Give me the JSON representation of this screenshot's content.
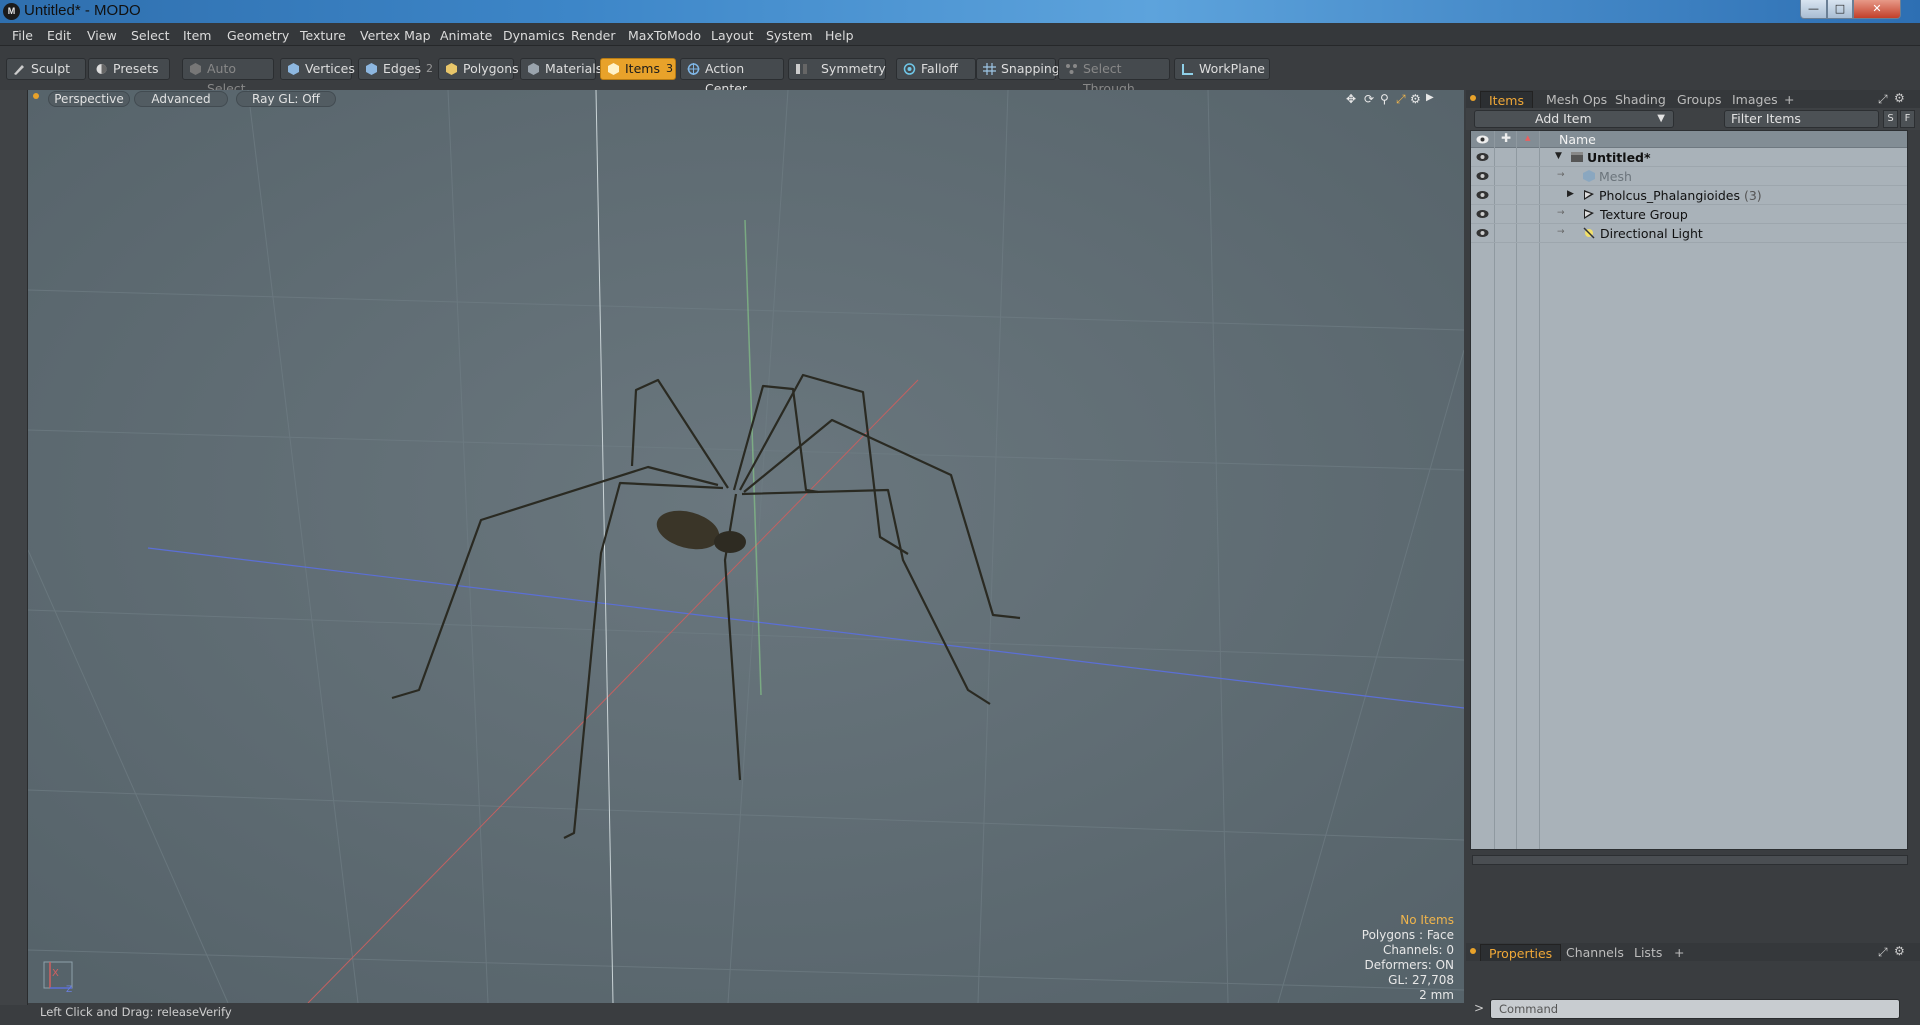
{
  "window": {
    "title": "Untitled* - MODO",
    "logo": "M"
  },
  "menu": [
    "File",
    "Edit",
    "View",
    "Select",
    "Item",
    "Geometry",
    "Texture",
    "Vertex Map",
    "Animate",
    "Dynamics",
    "Render",
    "MaxToModo",
    "Layout",
    "System",
    "Help"
  ],
  "toolbar": {
    "sculpt": "Sculpt",
    "presets": "Presets",
    "auto_select": "Auto Select",
    "vertices": "Vertices",
    "edges": "Edges",
    "edges_count": "2",
    "polygons": "Polygons",
    "materials": "Materials",
    "items": "Items",
    "items_count": "3",
    "action_center": "Action Center",
    "symmetry": "Symmetry",
    "falloff": "Falloff",
    "snapping": "Snapping",
    "select_through": "Select Through",
    "workplane": "WorkPlane"
  },
  "viewport": {
    "tabs": [
      "Perspective",
      "Advanced",
      "Ray GL: Off"
    ],
    "hud": {
      "selection": "No Items",
      "polygons": "Polygons : Face",
      "channels": "Channels: 0",
      "deformers": "Deformers: ON",
      "gl": "GL: 27,708",
      "scale": "2 mm"
    },
    "axis_x": "X",
    "axis_z": "Z"
  },
  "status": {
    "text": "Left Click and Drag:  releaseVerify"
  },
  "right_panel": {
    "tabs": [
      "Items",
      "Mesh Ops",
      "Shading",
      "Groups",
      "Images",
      "+"
    ],
    "add_item": "Add Item",
    "filter_placeholder": "Filter Items",
    "btn_s": "S",
    "btn_f": "F",
    "column_name": "Name",
    "tree": [
      {
        "label": "Untitled*",
        "icon": "scene-icon"
      },
      {
        "label": "Mesh",
        "icon": "mesh-icon"
      },
      {
        "label": "Pholcus_Phalangioides",
        "count": "(3)",
        "icon": "locator-icon"
      },
      {
        "label": "Texture Group",
        "icon": "group-icon"
      },
      {
        "label": "Directional Light",
        "icon": "light-icon"
      }
    ],
    "bottom_tabs": [
      "Properties",
      "Channels",
      "Lists",
      "+"
    ],
    "command_placeholder": "Command",
    "command_prompt": ">"
  }
}
